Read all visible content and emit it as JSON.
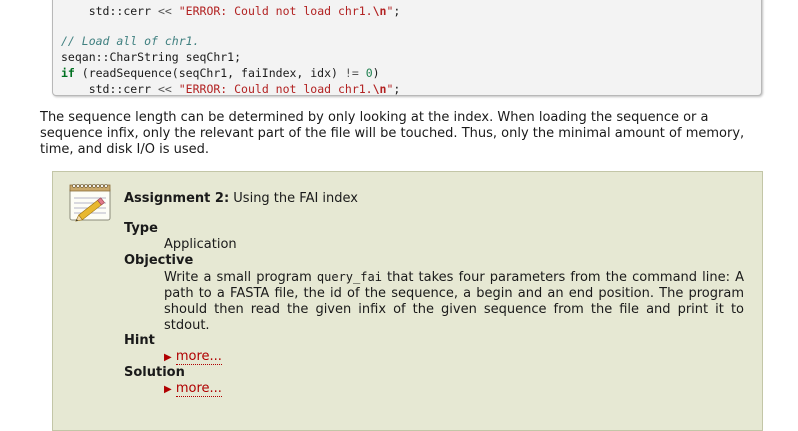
{
  "code": {
    "line0": {
      "indent": "    ",
      "text": "std::cerr << \"ERROR: Could not load chr1.\\n\";",
      "std": "std",
      "cerr": "::cerr ",
      "op": "<<",
      "str1": "\"ERROR: Could not load chr1.",
      "esc": "\\n",
      "str2": "\"",
      "semi": ";"
    },
    "comment": "// Load all of chr1.",
    "decl": "seqan::CharString seqChr1;",
    "cond": {
      "kw": "if",
      "mid": " (readSequence(seqChr1, faiIndex, idx) ",
      "op": "!=",
      "sp": " ",
      "num": "0",
      "close": ")"
    },
    "line4": {
      "indent": "    ",
      "std": "std",
      "cerr": "::cerr ",
      "op": "<<",
      "sp": " ",
      "str1": "\"ERROR: Could not load chr1.",
      "esc": "\\n",
      "str2": "\"",
      "semi": ";"
    }
  },
  "paragraph": "The sequence length can be determined by only looking at the index. When loading the sequence or a sequence infix, only the relevant part of the file will be touched. Thus, only the minimal amount of memory, time, and disk I/O is used.",
  "assignment": {
    "title_bold": "Assignment 2:",
    "title_rest": " Using the FAI index",
    "type_term": "Type",
    "type_value": "Application",
    "objective_term": "Objective",
    "objective_pre": "Write a small program ",
    "objective_code": "query_fai",
    "objective_post": " that takes four parameters from the command line: A path to a FASTA file, the id of the sequence, a begin and an end position. The program should then read the given infix of the given sequence from the file and print it to stdout.",
    "hint_term": "Hint",
    "hint_link": "more...",
    "solution_term": "Solution",
    "solution_link": "more...",
    "toggle_glyph": "▶"
  },
  "icon": {
    "name": "notepad-pencil-icon"
  },
  "colors": {
    "assignment_bg": "#e6e8d3",
    "assignment_border": "#c3c6a7",
    "link_red": "#b00000",
    "code_bg": "#f3f3f3"
  }
}
